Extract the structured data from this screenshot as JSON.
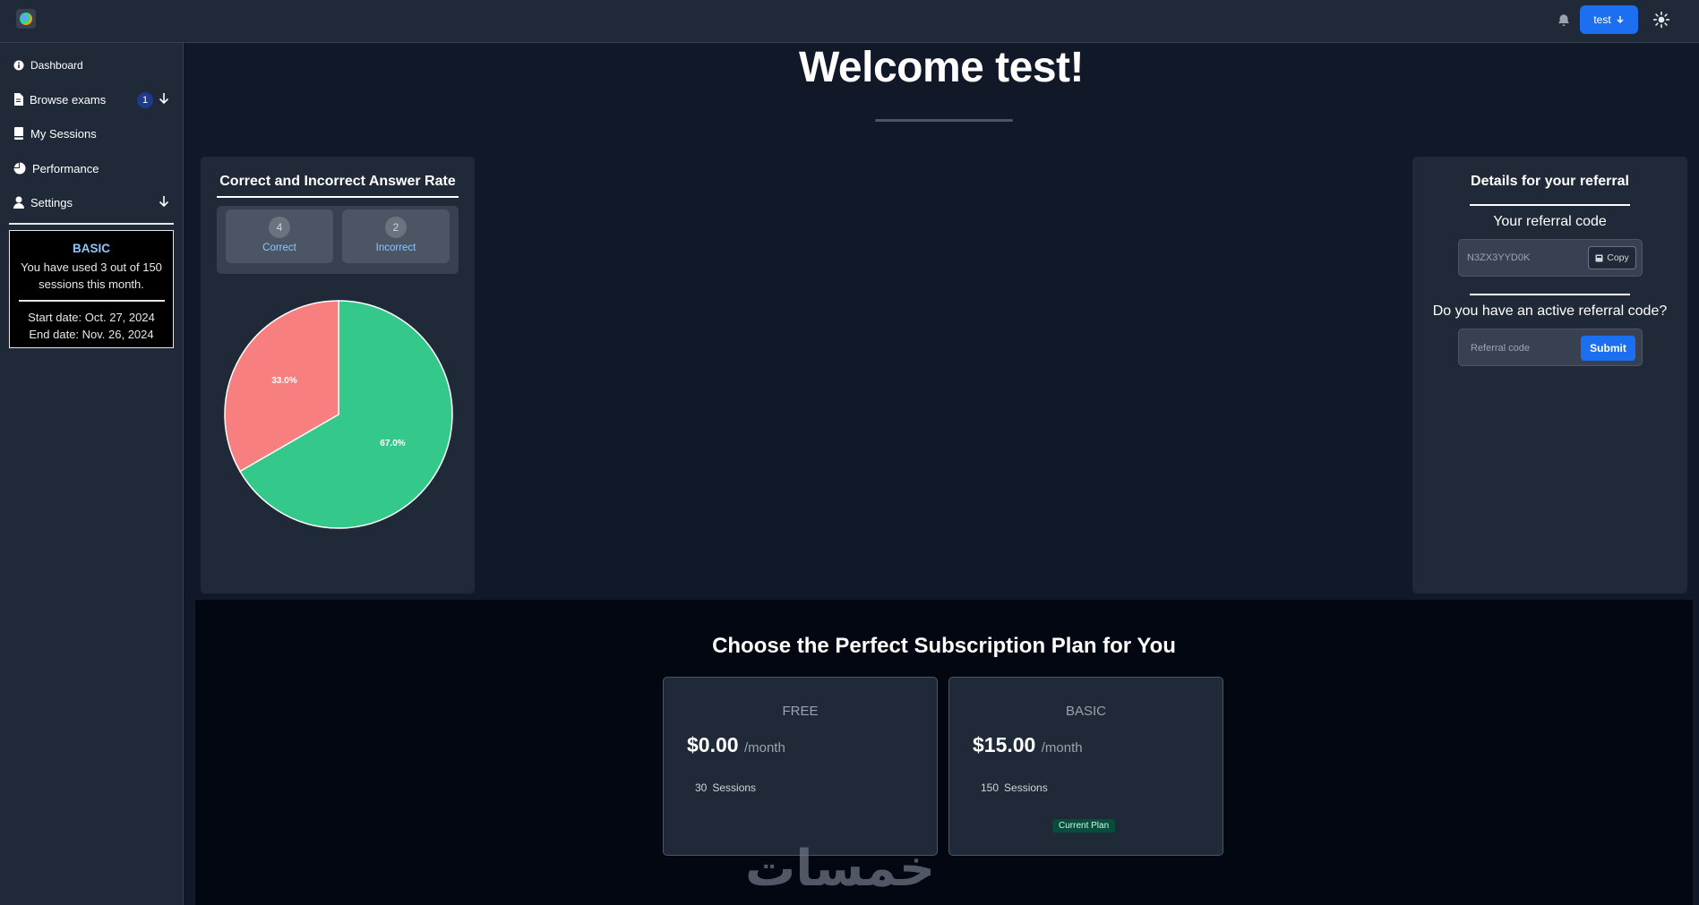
{
  "header": {
    "user_button_label": "test"
  },
  "sidebar": {
    "items": [
      {
        "label": "Dashboard"
      },
      {
        "label": "Browse exams",
        "badge": "1"
      },
      {
        "label": "My Sessions"
      },
      {
        "label": "Performance"
      },
      {
        "label": "Settings"
      }
    ],
    "plan": {
      "name": "BASIC",
      "usage": "You have used 3 out of 150 sessions this month.",
      "start": "Start date: Oct. 27, 2024",
      "end": "End date: Nov. 26, 2024"
    }
  },
  "main": {
    "title": "Welcome test!"
  },
  "answer_card": {
    "title": "Correct and Incorrect Answer Rate",
    "correct_count": "4",
    "correct_label": "Correct",
    "incorrect_count": "2",
    "incorrect_label": "Incorrect"
  },
  "chart_data": {
    "type": "pie",
    "labels": [
      "Correct",
      "Incorrect"
    ],
    "values": [
      4,
      2
    ],
    "percent_labels": [
      "67.0%",
      "33.0%"
    ],
    "colors": [
      "#34c98a",
      "#f87f7f"
    ]
  },
  "referral": {
    "title": "Details for your referral",
    "code_label": "Your referral code",
    "code_value": "N3ZX3YYD0K",
    "copy_label": "Copy",
    "active_question": "Do you have an active referral code?",
    "input_placeholder": "Referral code",
    "submit_label": "Submit"
  },
  "plans": {
    "title": "Choose the Perfect Subscription Plan for You",
    "items": [
      {
        "name": "FREE",
        "price": "$0.00",
        "period": "/month",
        "sessions_count": "30",
        "sessions_label": "Sessions"
      },
      {
        "name": "BASIC",
        "price": "$15.00",
        "period": "/month",
        "sessions_count": "150",
        "sessions_label": "Sessions",
        "badge": "Current Plan"
      }
    ]
  },
  "watermark": "خمسات"
}
